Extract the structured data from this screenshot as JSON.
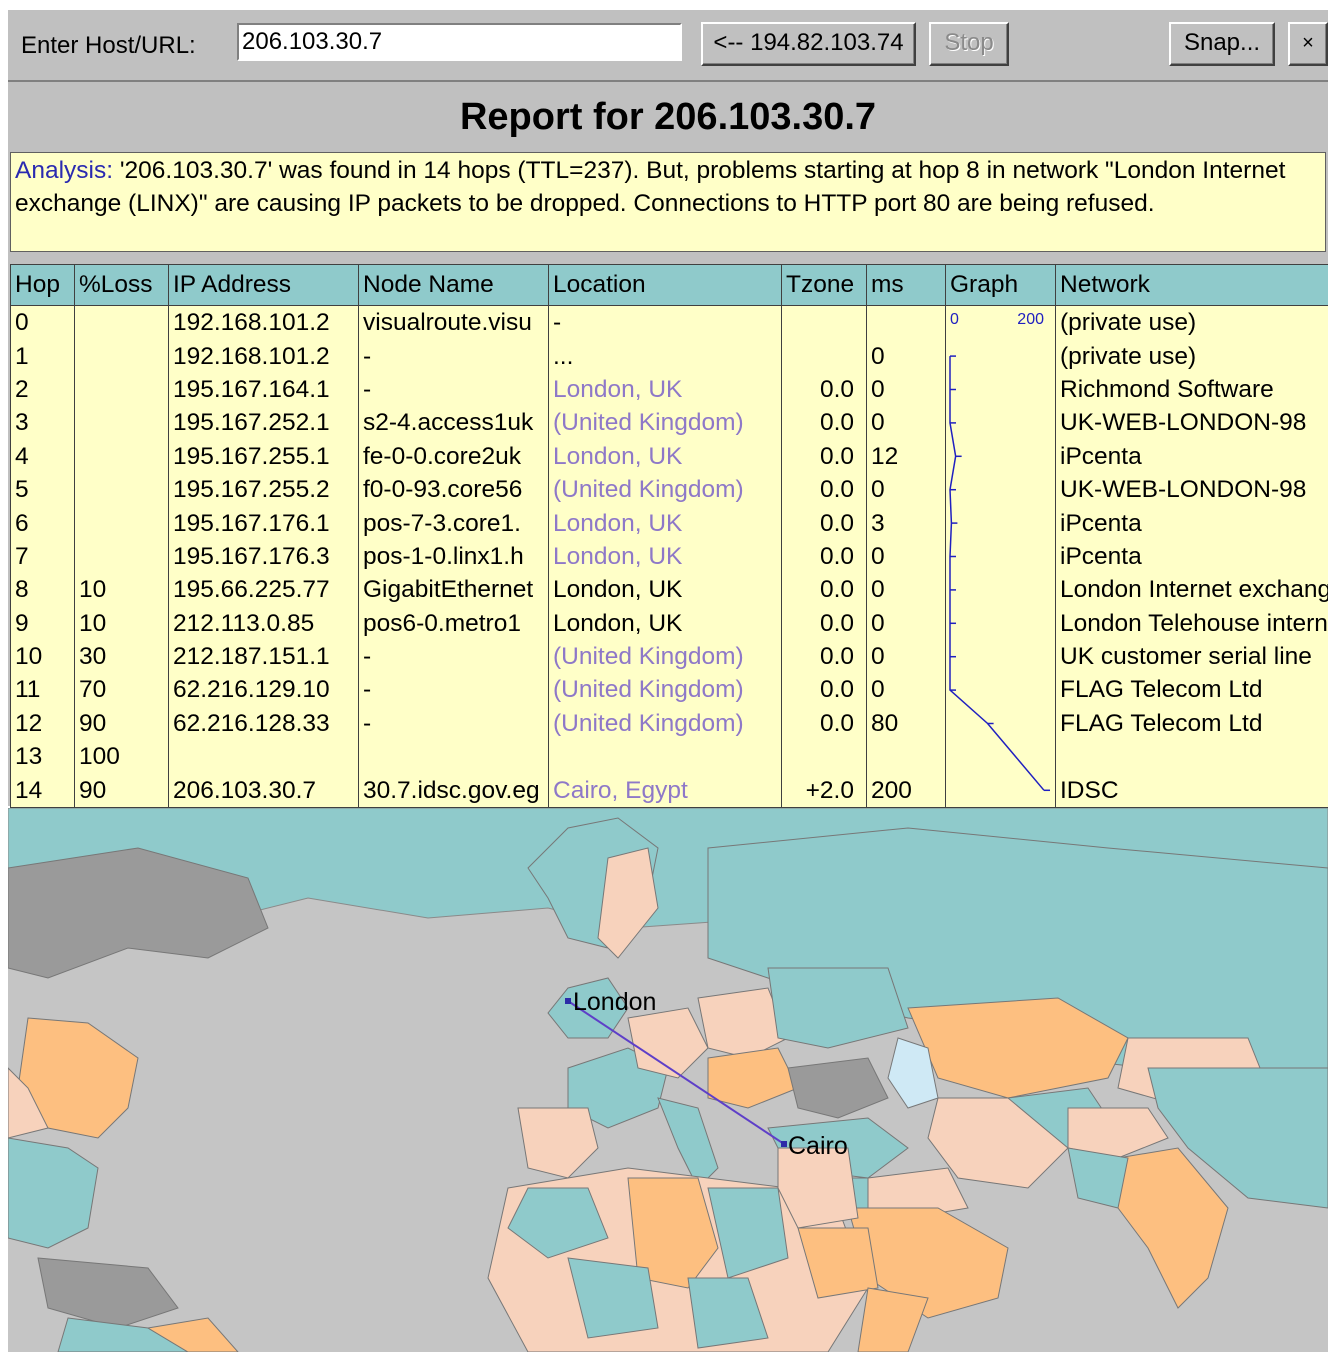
{
  "toolbar": {
    "url_label": "Enter Host/URL:",
    "url_value": "206.103.30.7",
    "back_button": "<-- 194.82.103.74",
    "stop_button": "Stop",
    "snap_button": "Snap...",
    "close_button": "×"
  },
  "report": {
    "title": "Report for 206.103.30.7",
    "analysis_label": "Analysis:",
    "analysis_text": " '206.103.30.7' was found in 14 hops (TTL=237). But, problems starting at hop 8 in network \"London Internet exchange (LINX)\" are causing IP packets to be dropped. Connections to HTTP port 80 are being refused."
  },
  "table": {
    "columns": [
      "Hop",
      "%Loss",
      "IP Address",
      "Node Name",
      "Location",
      "Tzone",
      "ms",
      "Graph",
      "Network"
    ],
    "graph_scale": {
      "min": "0",
      "max": "200"
    },
    "rows": [
      {
        "hop": "0",
        "loss": "",
        "ip": "192.168.101.2",
        "node": "visualroute.visu",
        "location": "-",
        "geo": false,
        "tzone": "",
        "ms": "",
        "network": "(private use)"
      },
      {
        "hop": "1",
        "loss": "",
        "ip": "192.168.101.2",
        "node": "-",
        "location": "...",
        "geo": false,
        "tzone": "",
        "ms": "0",
        "network": "(private use)"
      },
      {
        "hop": "2",
        "loss": "",
        "ip": "195.167.164.1",
        "node": "-",
        "location": "London, UK",
        "geo": true,
        "tzone": "0.0",
        "ms": "0",
        "network": "Richmond Software"
      },
      {
        "hop": "3",
        "loss": "",
        "ip": "195.167.252.1",
        "node": "s2-4.access1uk",
        "location": "(United Kingdom)",
        "geo": true,
        "tzone": "0.0",
        "ms": "0",
        "network": "UK-WEB-LONDON-98"
      },
      {
        "hop": "4",
        "loss": "",
        "ip": "195.167.255.1",
        "node": "fe-0-0.core2uk",
        "location": "London, UK",
        "geo": true,
        "tzone": "0.0",
        "ms": "12",
        "network": "iPcenta"
      },
      {
        "hop": "5",
        "loss": "",
        "ip": "195.167.255.2",
        "node": "f0-0-93.core56",
        "location": "(United Kingdom)",
        "geo": true,
        "tzone": "0.0",
        "ms": "0",
        "network": "UK-WEB-LONDON-98"
      },
      {
        "hop": "6",
        "loss": "",
        "ip": "195.167.176.1",
        "node": "pos-7-3.core1.",
        "location": "London, UK",
        "geo": true,
        "tzone": "0.0",
        "ms": "3",
        "network": "iPcenta"
      },
      {
        "hop": "7",
        "loss": "",
        "ip": "195.167.176.3",
        "node": "pos-1-0.linx1.h",
        "location": "London, UK",
        "geo": true,
        "tzone": "0.0",
        "ms": "0",
        "network": "iPcenta"
      },
      {
        "hop": "8",
        "loss": "10",
        "ip": "195.66.225.77",
        "node": "GigabitEthernet",
        "location": "London, UK",
        "geo": false,
        "tzone": "0.0",
        "ms": "0",
        "network": "London Internet exchange"
      },
      {
        "hop": "9",
        "loss": "10",
        "ip": "212.113.0.85",
        "node": "pos6-0.metro1",
        "location": "London, UK",
        "geo": false,
        "tzone": "0.0",
        "ms": "0",
        "network": "London Telehouse internet"
      },
      {
        "hop": "10",
        "loss": "30",
        "ip": "212.187.151.1",
        "node": "-",
        "location": "(United Kingdom)",
        "geo": true,
        "tzone": "0.0",
        "ms": "0",
        "network": "UK customer serial line"
      },
      {
        "hop": "11",
        "loss": "70",
        "ip": "62.216.129.10",
        "node": "-",
        "location": "(United Kingdom)",
        "geo": true,
        "tzone": "0.0",
        "ms": "0",
        "network": "FLAG Telecom Ltd"
      },
      {
        "hop": "12",
        "loss": "90",
        "ip": "62.216.128.33",
        "node": "-",
        "location": "(United Kingdom)",
        "geo": true,
        "tzone": "0.0",
        "ms": "80",
        "network": "FLAG Telecom Ltd"
      },
      {
        "hop": "13",
        "loss": "100",
        "ip": "",
        "node": "",
        "location": "",
        "geo": false,
        "tzone": "",
        "ms": "",
        "network": ""
      },
      {
        "hop": "14",
        "loss": "90",
        "ip": "206.103.30.7",
        "node": "30.7.idsc.gov.eg",
        "location": "Cairo, Egypt",
        "geo": true,
        "tzone": "+2.0",
        "ms": "200",
        "network": "IDSC"
      }
    ]
  },
  "map": {
    "cities": [
      {
        "name": "London"
      },
      {
        "name": "Cairo"
      }
    ],
    "colors": {
      "sea": "#c5c5c5",
      "land_teal": "#8fcacb",
      "land_peach": "#f7d2bc",
      "land_orange": "#fdbf80",
      "land_gray": "#9a9a9a",
      "route": "#5e3fc8"
    }
  }
}
